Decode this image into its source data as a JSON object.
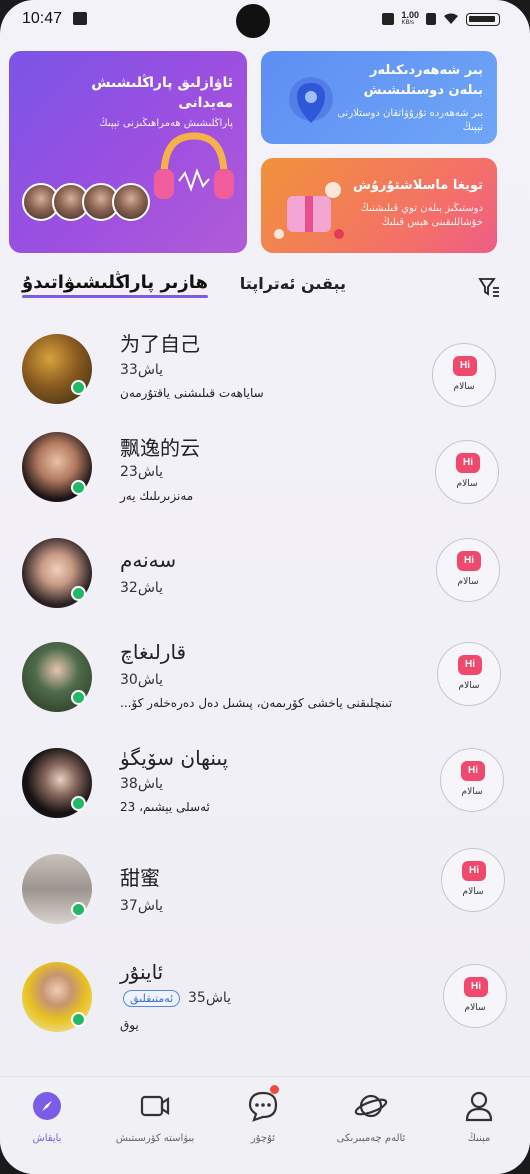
{
  "status_bar": {
    "time": "10:47",
    "net_speed_value": "1.00",
    "net_speed_unit": "KB/s"
  },
  "banners": {
    "voice_room": {
      "title": "ئاۋازلىق پاراڭلىشىش مەيدانى",
      "subtitle": "پاراڭلىشىش ھەمراھىڭىزنى تېپىڭ"
    },
    "same_city": {
      "title": "بىر شەھەردىكىلەر بىلەن دوستلىشىش",
      "subtitle": "بىر شەھەردە تۇرۇۋاتقان دوستلارنى تېپىڭ"
    },
    "wedding": {
      "title": "تويغا ماسلاشتۇرۇش",
      "subtitle": "دوستىڭىز بىلەن توي قىلىشنىڭ خۇشاللىقىنى ھېس قىلىڭ"
    }
  },
  "tabs": {
    "online": "ھازىر پاراڭلىشىۋاتىدۇ",
    "nearby": "يېقىن ئەتراپتا"
  },
  "users": [
    {
      "name": "为了自己",
      "age": "33ياش",
      "desc": "ساياھەت قىلىشنى ياقتۇرمەن",
      "online": true
    },
    {
      "name": "飘逸的云",
      "age": "23ياش",
      "desc": "مەنزىرىلىك يەر",
      "online": true
    },
    {
      "name": "سەنەم",
      "age": "32ياش",
      "desc": "",
      "online": true
    },
    {
      "name": "قارلىغاچ",
      "age": "30ياش",
      "desc": "تىنچلىقنى ياخشى كۆرىمەن، پىشىل دەل دەرەخلەر كۆ...",
      "online": true
    },
    {
      "name": "پىنھان سۆيگۈ",
      "age": "38ياش",
      "desc": "ئەسلى يېشىم، 23",
      "online": true
    },
    {
      "name": "甜蜜",
      "age": "37ياش",
      "desc": "",
      "online": true
    },
    {
      "name": "ئاينۇر",
      "age": "35ياش",
      "badge": "ئەمتىقلىق",
      "desc": "يوق",
      "online": true
    }
  ],
  "greet": {
    "hi": "Hi",
    "label": "سالام"
  },
  "nav": [
    {
      "label": "بايقاش",
      "icon": "compass-icon",
      "active": true
    },
    {
      "label": "بىۋاستە كۆرسىتىش",
      "icon": "video-icon",
      "active": false
    },
    {
      "label": "ئۇچۇر",
      "icon": "chat-bubble-icon",
      "active": false,
      "badge": true
    },
    {
      "label": "ئالەم چەمبىرىكى",
      "icon": "planet-icon",
      "active": false
    },
    {
      "label": "مېنىڭ",
      "icon": "person-icon",
      "active": false
    }
  ],
  "colors": {
    "accent": "#7b5ce6",
    "online": "#23b867",
    "hi": "#ef4a6e"
  }
}
